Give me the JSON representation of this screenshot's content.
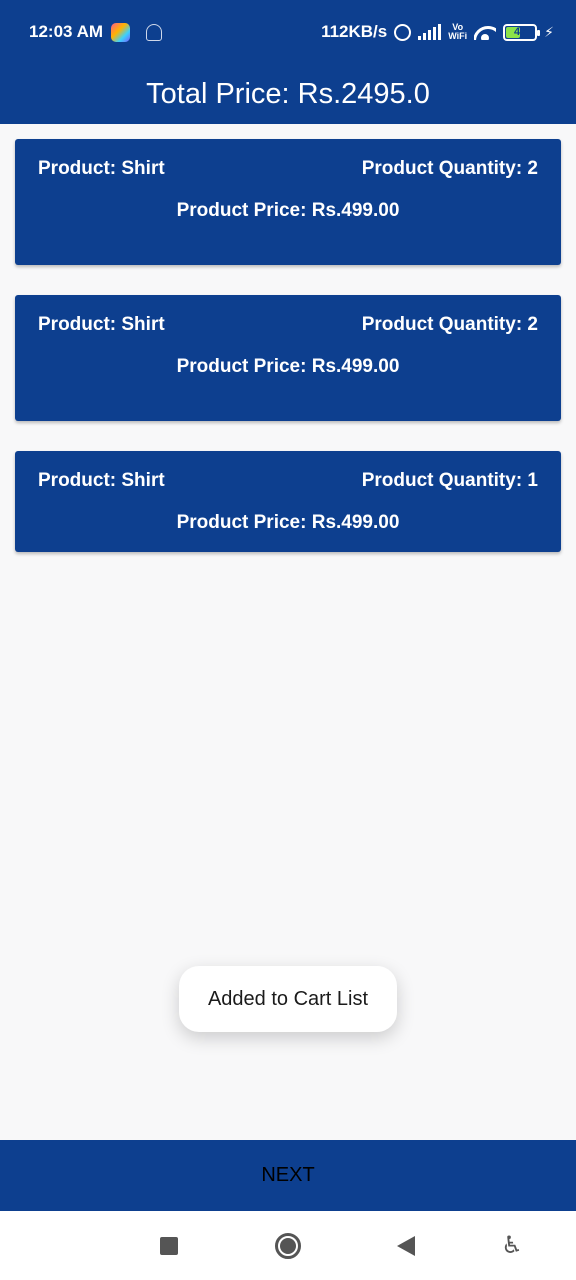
{
  "status_bar": {
    "time": "12:03 AM",
    "net_speed": "112KB/s",
    "vowifi_top": "Vo",
    "vowifi_bottom": "WiFi",
    "battery": "47",
    "icons": [
      "q-app-icon",
      "ghost-app-icon",
      "alarm-icon",
      "signal-icon",
      "wifi-icon",
      "battery-icon",
      "charging-icon"
    ]
  },
  "app_bar": {
    "title": "Total Price: Rs.2495.0"
  },
  "cart_items": [
    {
      "product": "Product: Shirt",
      "quantity": "Product Quantity: 2",
      "price": "Product Price: Rs.499.00"
    },
    {
      "product": "Product: Shirt",
      "quantity": "Product Quantity: 2",
      "price": "Product Price: Rs.499.00"
    },
    {
      "product": "Product: Shirt",
      "quantity": "Product Quantity: 1",
      "price": "Product Price: Rs.499.00"
    }
  ],
  "toast": {
    "message": "Added to Cart List"
  },
  "footer": {
    "next_label": "NEXT"
  },
  "nav_bar": {
    "icons": [
      "recents-square-icon",
      "home-circle-icon",
      "back-triangle-icon",
      "accessibility-icon"
    ]
  },
  "colors": {
    "primary": "#0d3f8f",
    "background": "#f8f8f9",
    "toast_bg": "#ffffff"
  }
}
